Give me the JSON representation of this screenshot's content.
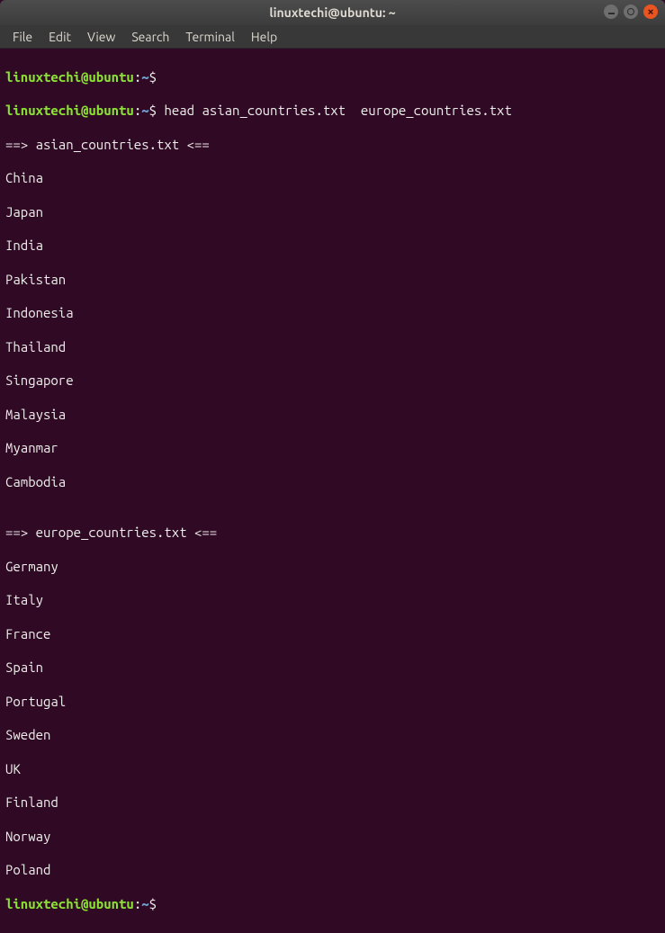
{
  "titlebar": {
    "title": "linuxtechi@ubuntu: ~"
  },
  "menubar": {
    "items": [
      {
        "label": "File"
      },
      {
        "label": "Edit"
      },
      {
        "label": "View"
      },
      {
        "label": "Search"
      },
      {
        "label": "Terminal"
      },
      {
        "label": "Help"
      }
    ]
  },
  "terminal": {
    "prompt_user": "linuxtechi@ubuntu",
    "prompt_sep": ":",
    "prompt_path": "~",
    "prompt_end": "$",
    "command1": "",
    "command2": "head asian_countries.txt  europe_countries.txt",
    "header1": "==> asian_countries.txt <==",
    "header2": "==> europe_countries.txt <==",
    "asian": [
      "China",
      "Japan",
      "India",
      "Pakistan",
      "Indonesia",
      "Thailand",
      "Singapore",
      "Malaysia",
      "Myanmar",
      "Cambodia"
    ],
    "europe": [
      "Germany",
      "Italy",
      "France",
      "Spain",
      "Portugal",
      "Sweden",
      "UK",
      "Finland",
      "Norway",
      "Poland"
    ],
    "blank": ""
  }
}
